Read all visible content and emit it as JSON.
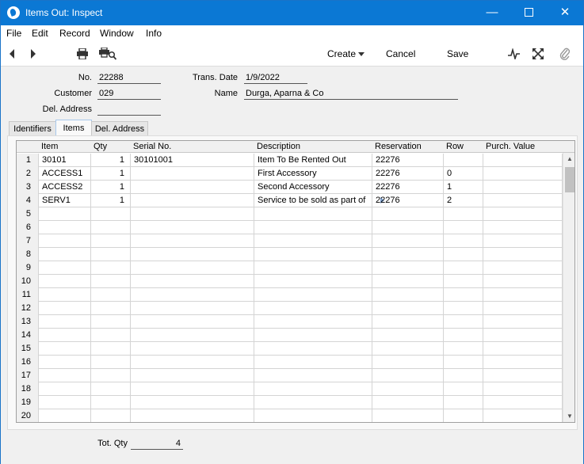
{
  "window": {
    "title": "Items Out: Inspect",
    "minimize_glyph": "—",
    "close_glyph": "✕"
  },
  "menu": [
    "File",
    "Edit",
    "Record",
    "Window",
    "Info"
  ],
  "toolbar": {
    "create_label": "Create",
    "cancel_label": "Cancel",
    "save_label": "Save",
    "icons": [
      "arrow-left-icon",
      "arrow-right-icon",
      "printer-icon",
      "print-preview-icon",
      "activity-icon",
      "expand-icon",
      "paperclip-icon"
    ]
  },
  "header": {
    "no_label": "No.",
    "no_value": "22288",
    "customer_label": "Customer",
    "customer_value": "029",
    "del_address_label": "Del. Address",
    "del_address_value": "",
    "trans_date_label": "Trans. Date",
    "trans_date_value": "1/9/2022",
    "name_label": "Name",
    "name_value": "Durga, Aparna & Co"
  },
  "tabs": [
    {
      "label": "Identifiers",
      "active": false
    },
    {
      "label": "Items",
      "active": true
    },
    {
      "label": "Del. Address",
      "active": false
    }
  ],
  "grid": {
    "columns": [
      "Item",
      "Qty",
      "Serial No.",
      "Description",
      "Reservation",
      "Row",
      "Purch. Value"
    ],
    "rows": [
      {
        "no": "1",
        "item": "30101",
        "qty": "1",
        "serial": "30101001",
        "description": "Item To Be Rented Out",
        "reservation": "22276",
        "row": "",
        "purch_value": ""
      },
      {
        "no": "2",
        "item": "ACCESS1",
        "qty": "1",
        "serial": "",
        "description": "First Accessory",
        "reservation": "22276",
        "row": "0",
        "purch_value": ""
      },
      {
        "no": "3",
        "item": "ACCESS2",
        "qty": "1",
        "serial": "",
        "description": "Second Accessory",
        "reservation": "22276",
        "row": "1",
        "purch_value": ""
      },
      {
        "no": "4",
        "item": "SERV1",
        "qty": "1",
        "serial": "",
        "description": "Service to be sold as part of",
        "reservation": "22276",
        "row": "2",
        "purch_value": ""
      },
      {
        "no": "5",
        "item": "",
        "qty": "",
        "serial": "",
        "description": "",
        "reservation": "",
        "row": "",
        "purch_value": ""
      },
      {
        "no": "6",
        "item": "",
        "qty": "",
        "serial": "",
        "description": "",
        "reservation": "",
        "row": "",
        "purch_value": ""
      },
      {
        "no": "7",
        "item": "",
        "qty": "",
        "serial": "",
        "description": "",
        "reservation": "",
        "row": "",
        "purch_value": ""
      },
      {
        "no": "8",
        "item": "",
        "qty": "",
        "serial": "",
        "description": "",
        "reservation": "",
        "row": "",
        "purch_value": ""
      },
      {
        "no": "9",
        "item": "",
        "qty": "",
        "serial": "",
        "description": "",
        "reservation": "",
        "row": "",
        "purch_value": ""
      },
      {
        "no": "10",
        "item": "",
        "qty": "",
        "serial": "",
        "description": "",
        "reservation": "",
        "row": "",
        "purch_value": ""
      },
      {
        "no": "11",
        "item": "",
        "qty": "",
        "serial": "",
        "description": "",
        "reservation": "",
        "row": "",
        "purch_value": ""
      },
      {
        "no": "12",
        "item": "",
        "qty": "",
        "serial": "",
        "description": "",
        "reservation": "",
        "row": "",
        "purch_value": ""
      },
      {
        "no": "13",
        "item": "",
        "qty": "",
        "serial": "",
        "description": "",
        "reservation": "",
        "row": "",
        "purch_value": ""
      },
      {
        "no": "14",
        "item": "",
        "qty": "",
        "serial": "",
        "description": "",
        "reservation": "",
        "row": "",
        "purch_value": ""
      },
      {
        "no": "15",
        "item": "",
        "qty": "",
        "serial": "",
        "description": "",
        "reservation": "",
        "row": "",
        "purch_value": ""
      },
      {
        "no": "16",
        "item": "",
        "qty": "",
        "serial": "",
        "description": "",
        "reservation": "",
        "row": "",
        "purch_value": ""
      },
      {
        "no": "17",
        "item": "",
        "qty": "",
        "serial": "",
        "description": "",
        "reservation": "",
        "row": "",
        "purch_value": ""
      },
      {
        "no": "18",
        "item": "",
        "qty": "",
        "serial": "",
        "description": "",
        "reservation": "",
        "row": "",
        "purch_value": ""
      },
      {
        "no": "19",
        "item": "",
        "qty": "",
        "serial": "",
        "description": "",
        "reservation": "",
        "row": "",
        "purch_value": ""
      },
      {
        "no": "20",
        "item": "",
        "qty": "",
        "serial": "",
        "description": "",
        "reservation": "",
        "row": "",
        "purch_value": ""
      }
    ]
  },
  "footer": {
    "tot_qty_label": "Tot. Qty",
    "tot_qty_value": "4"
  },
  "colors": {
    "titlebar": "#0b78d4",
    "window_bg": "#f0f0f0",
    "active_tab_border": "#a8c9ec"
  }
}
